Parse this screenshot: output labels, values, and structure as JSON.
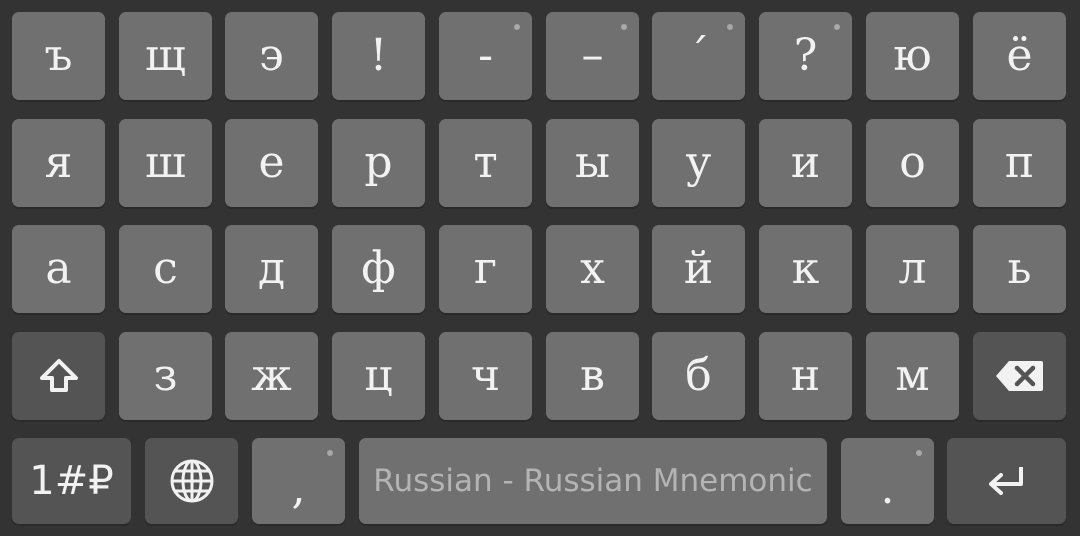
{
  "rows": [
    [
      "ъ",
      "щ",
      "э",
      "!",
      "-",
      "–",
      "´",
      "?",
      "ю",
      "ё"
    ],
    [
      "я",
      "ш",
      "е",
      "р",
      "т",
      "ы",
      "у",
      "и",
      "о",
      "п"
    ],
    [
      "а",
      "с",
      "д",
      "ф",
      "г",
      "х",
      "й",
      "к",
      "л",
      "ь"
    ],
    [
      "з",
      "ж",
      "ц",
      "ч",
      "в",
      "б",
      "н",
      "м"
    ]
  ],
  "symbols_label": "1#₽",
  "comma": ",",
  "period": ".",
  "space_label": "Russian - Russian Mnemonic",
  "icons": {
    "shift": "shift-icon",
    "backspace": "backspace-icon",
    "globe": "globe-icon",
    "enter": "enter-icon"
  },
  "colors": {
    "background": "#333333",
    "key": "#707070",
    "function_key": "#545454",
    "text": "#f2f2f2"
  }
}
